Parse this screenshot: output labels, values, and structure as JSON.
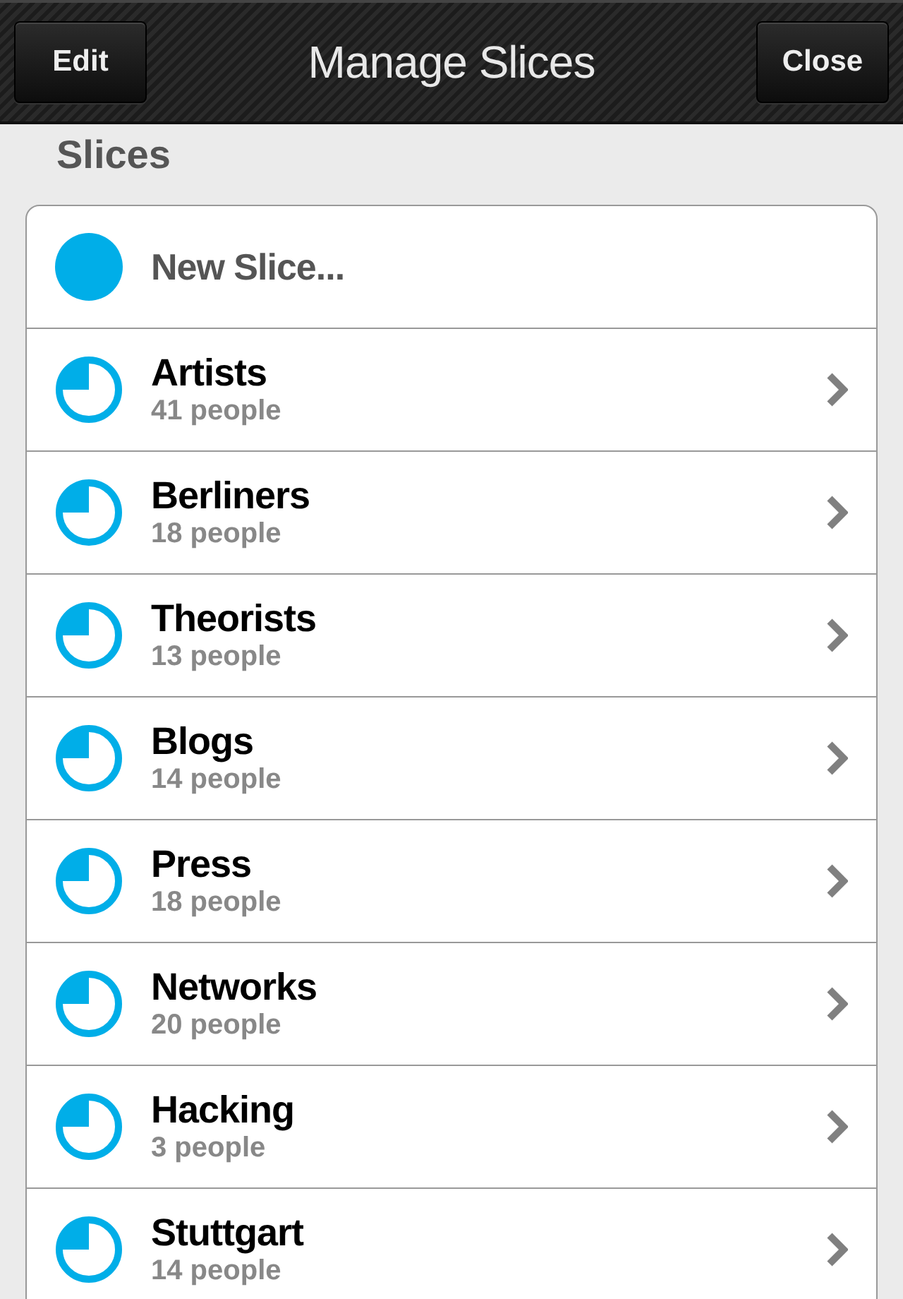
{
  "nav_bar": {
    "left_button": "Edit",
    "title": "Manage Slices",
    "right_button": "Close"
  },
  "section_title": "Slices",
  "slices": [
    {
      "kind": "new",
      "name": "New Slice..."
    },
    {
      "kind": "slice",
      "name": "Artists",
      "count": "41 people"
    },
    {
      "kind": "slice",
      "name": "Berliners",
      "count": "18 people"
    },
    {
      "kind": "slice",
      "name": "Theorists",
      "count": "13 people"
    },
    {
      "kind": "slice",
      "name": "Blogs",
      "count": "14 people"
    },
    {
      "kind": "slice",
      "name": "Press",
      "count": "18 people"
    },
    {
      "kind": "slice",
      "name": "Networks",
      "count": "20 people"
    },
    {
      "kind": "slice",
      "name": "Hacking",
      "count": "3 people"
    },
    {
      "kind": "slice",
      "name": "Stuttgart",
      "count": "14 people"
    }
  ]
}
